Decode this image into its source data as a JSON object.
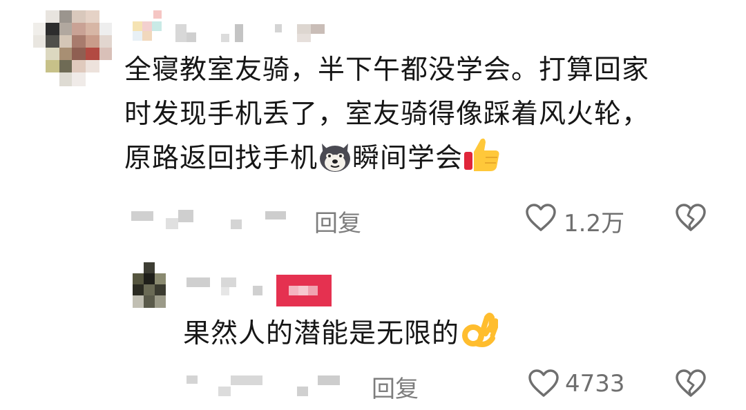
{
  "comment": {
    "text_lines": [
      "全寝教室友骑，半下午都没学会。打算回家",
      "时发现手机丢了，室友骑得像踩着风火轮，",
      "原路返回找手机"
    ],
    "text_tail": "瞬间学会",
    "reply_label": "回复",
    "like_count": "1.2万",
    "icons": [
      "dog-emoji-icon",
      "thumbs-up-emoji-icon",
      "heart-outline-icon",
      "broken-heart-icon"
    ]
  },
  "reply": {
    "text": "果然人的潜能是无限的",
    "reply_label": "回复",
    "like_count": "4733",
    "icons": [
      "ok-hand-emoji-icon",
      "heart-outline-icon",
      "broken-heart-icon"
    ]
  }
}
